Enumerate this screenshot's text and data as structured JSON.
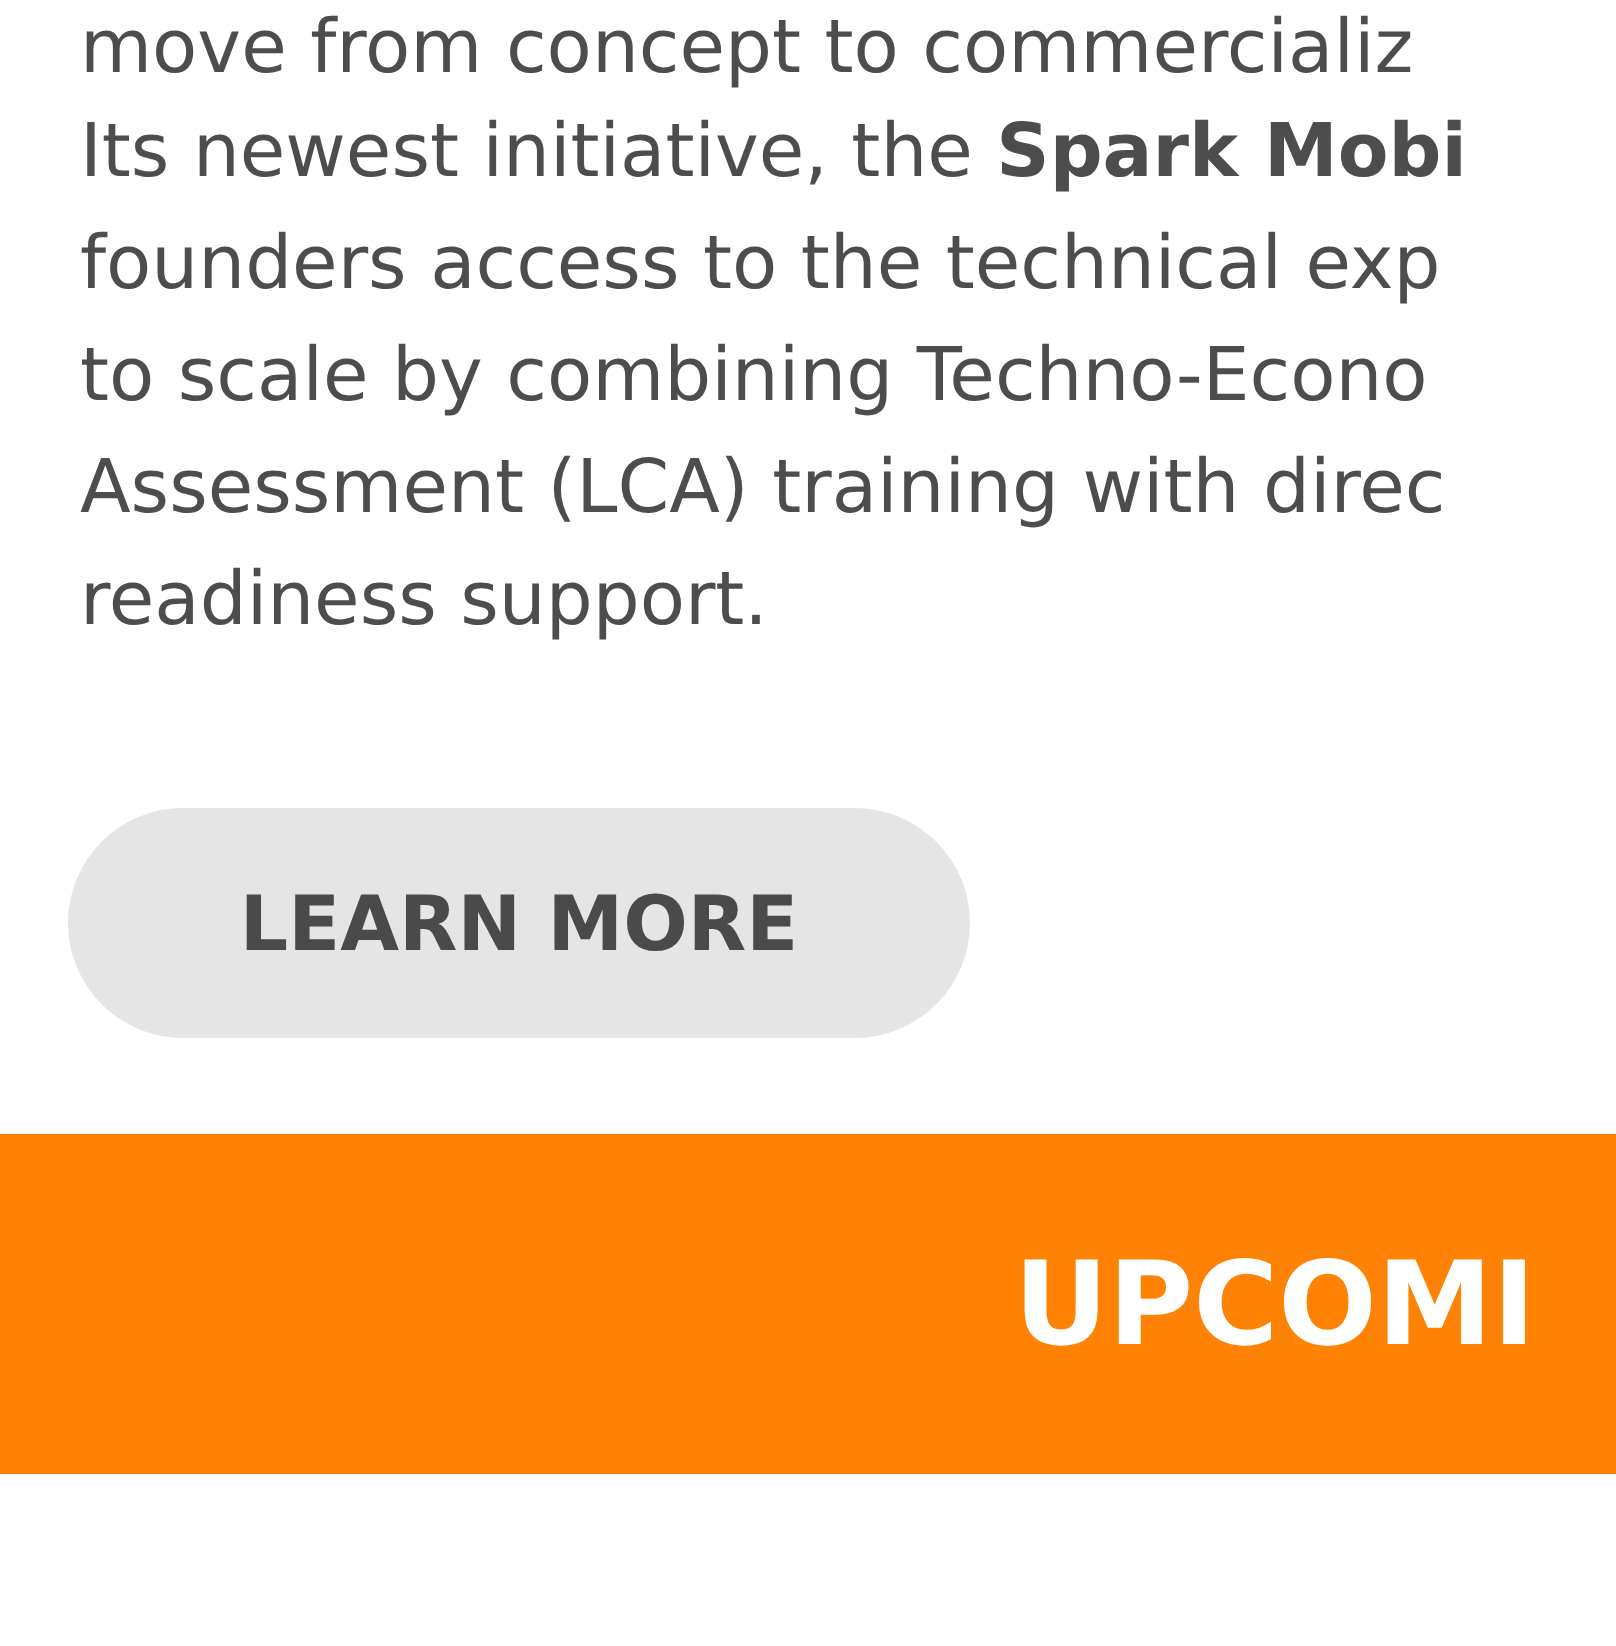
{
  "intro_line": "move from concept to commercializ",
  "paragraph_lines": [
    "Its newest initiative, the **Spark Mobi**",
    "founders access to the technical exp",
    "to scale by combining Techno-Econo",
    "Assessment (LCA) training with direc",
    "readiness support."
  ],
  "button": "LEARN MORE",
  "banner": {
    "heading": "UPCOMI"
  }
}
